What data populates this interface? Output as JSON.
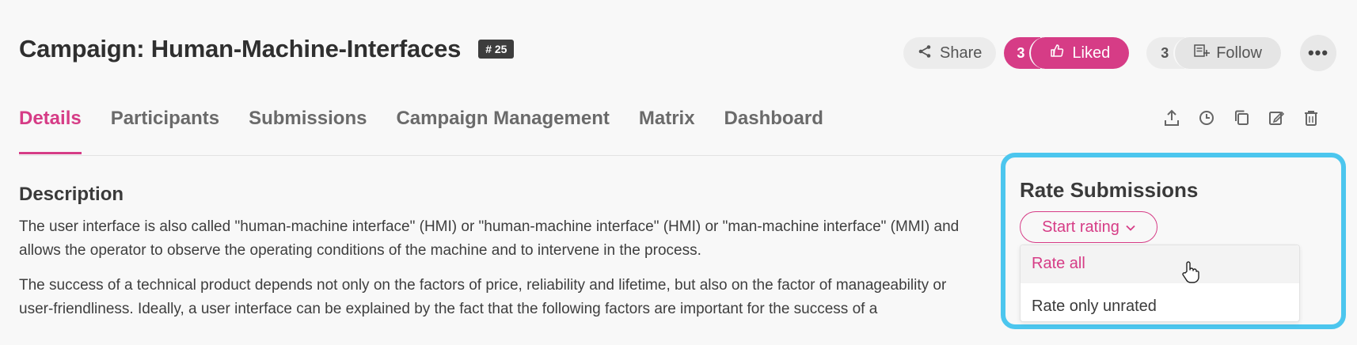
{
  "header": {
    "title": "Campaign: Human-Machine-Interfaces",
    "id_badge": "# 25",
    "share_label": "Share",
    "like_count": "3",
    "like_label": "Liked",
    "follow_count": "3",
    "follow_label": "Follow",
    "more_label": "•••"
  },
  "tabs": [
    {
      "label": "Details"
    },
    {
      "label": "Participants"
    },
    {
      "label": "Submissions"
    },
    {
      "label": "Campaign Management"
    },
    {
      "label": "Matrix"
    },
    {
      "label": "Dashboard"
    }
  ],
  "icons": {
    "share": "share-icon",
    "like": "thumbs-up-icon",
    "follow": "follow-icon",
    "tools": [
      "upload-icon",
      "clock-icon",
      "copy-icon",
      "edit-icon",
      "trash-icon"
    ]
  },
  "description": {
    "title": "Description",
    "paragraph1": "The user interface is also called \"human-machine interface\" (HMI) or \"human-machine interface\" (HMI) or \"man-machine interface\" (MMI) and allows the operator to observe the operating conditions of the machine and to intervene in the process.",
    "paragraph2": "The success of a technical product depends not only on the factors of price, reliability and lifetime, but also on the factor of manageability or user-friendliness. Ideally, a user interface can be explained by the fact that the following factors are important for the success of a"
  },
  "rate_panel": {
    "title": "Rate Submissions",
    "start_button": "Start rating",
    "options": [
      "Rate all",
      "Rate only unrated"
    ]
  },
  "colors": {
    "accent": "#d63c86",
    "highlight_border": "#4cc6ee"
  }
}
